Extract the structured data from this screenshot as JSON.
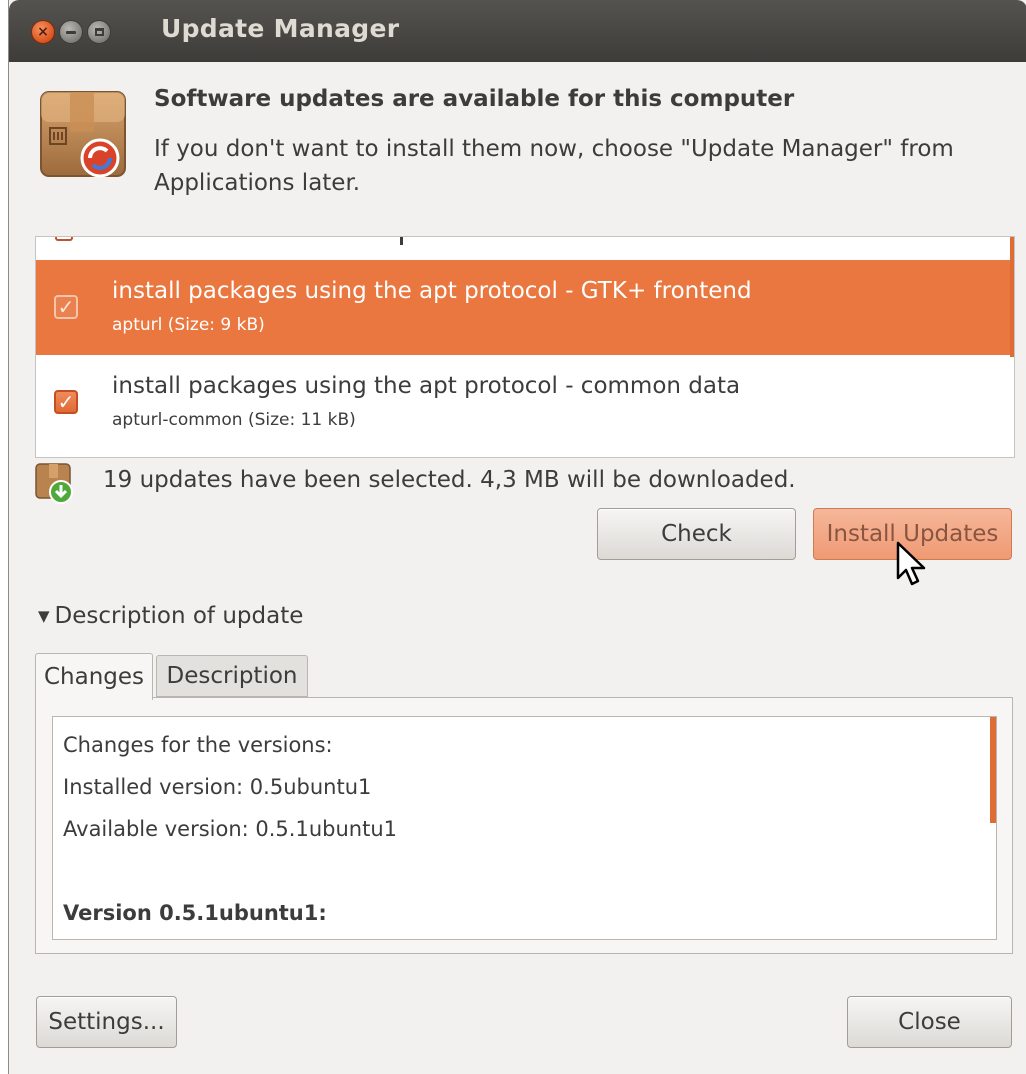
{
  "window": {
    "title": "Update Manager"
  },
  "header": {
    "heading": "Software updates are available for this computer",
    "subtext": "If you don't want to install them now, choose \"Update Manager\" from Applications later."
  },
  "updates": {
    "items": [
      {
        "name": "install packages using the apt protocol - GTK+ frontend",
        "detail": "apturl (Size: 9 kB)",
        "checked": true,
        "selected": true
      },
      {
        "name": "install packages using the apt protocol - common data",
        "detail": "apturl-common (Size: 11 kB)",
        "checked": true,
        "selected": false
      }
    ],
    "status": "19 updates have been selected. 4,3 MB will be downloaded."
  },
  "buttons": {
    "check": "Check",
    "install": "Install Updates",
    "settings": "Settings...",
    "close": "Close"
  },
  "description": {
    "expander_label": "Description of update",
    "tabs": [
      "Changes",
      "Description"
    ],
    "active_tab": "Changes",
    "changes_lines": [
      "Changes for the versions:",
      "Installed version: 0.5ubuntu1",
      "Available version: 0.5.1ubuntu1",
      "",
      "Version 0.5.1ubuntu1:"
    ]
  },
  "colors": {
    "accent": "#e9773f",
    "titlebar": "#3d3c39",
    "window_bg": "#f2f1f0"
  }
}
